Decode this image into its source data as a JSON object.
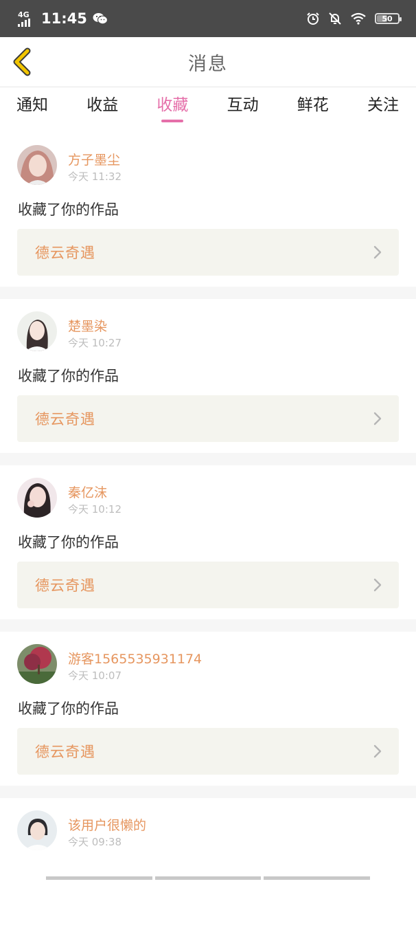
{
  "status_bar": {
    "network": "4G",
    "time": "11:45",
    "battery": "50",
    "battery_level": 0.5
  },
  "header": {
    "title": "消息"
  },
  "tabs": [
    {
      "label": "通知",
      "active": false
    },
    {
      "label": "收益",
      "active": false
    },
    {
      "label": "收藏",
      "active": true
    },
    {
      "label": "互动",
      "active": false
    },
    {
      "label": "鲜花",
      "active": false
    },
    {
      "label": "关注",
      "active": false
    }
  ],
  "messages": [
    {
      "user": "方子墨尘",
      "time": "今天 11:32",
      "action": "收藏了你的作品",
      "work": "德云奇遇"
    },
    {
      "user": "楚墨染",
      "time": "今天 10:27",
      "action": "收藏了你的作品",
      "work": "德云奇遇"
    },
    {
      "user": "秦亿沫",
      "time": "今天 10:12",
      "action": "收藏了你的作品",
      "work": "德云奇遇"
    },
    {
      "user": "游客1565535931174",
      "time": "今天 10:07",
      "action": "收藏了你的作品",
      "work": "德云奇遇"
    },
    {
      "user": "该用户很懒的",
      "time": "今天 09:38"
    }
  ],
  "colors": {
    "accent": "#e56fa9",
    "username": "#e6965f",
    "back_icon": "#e0b400"
  }
}
